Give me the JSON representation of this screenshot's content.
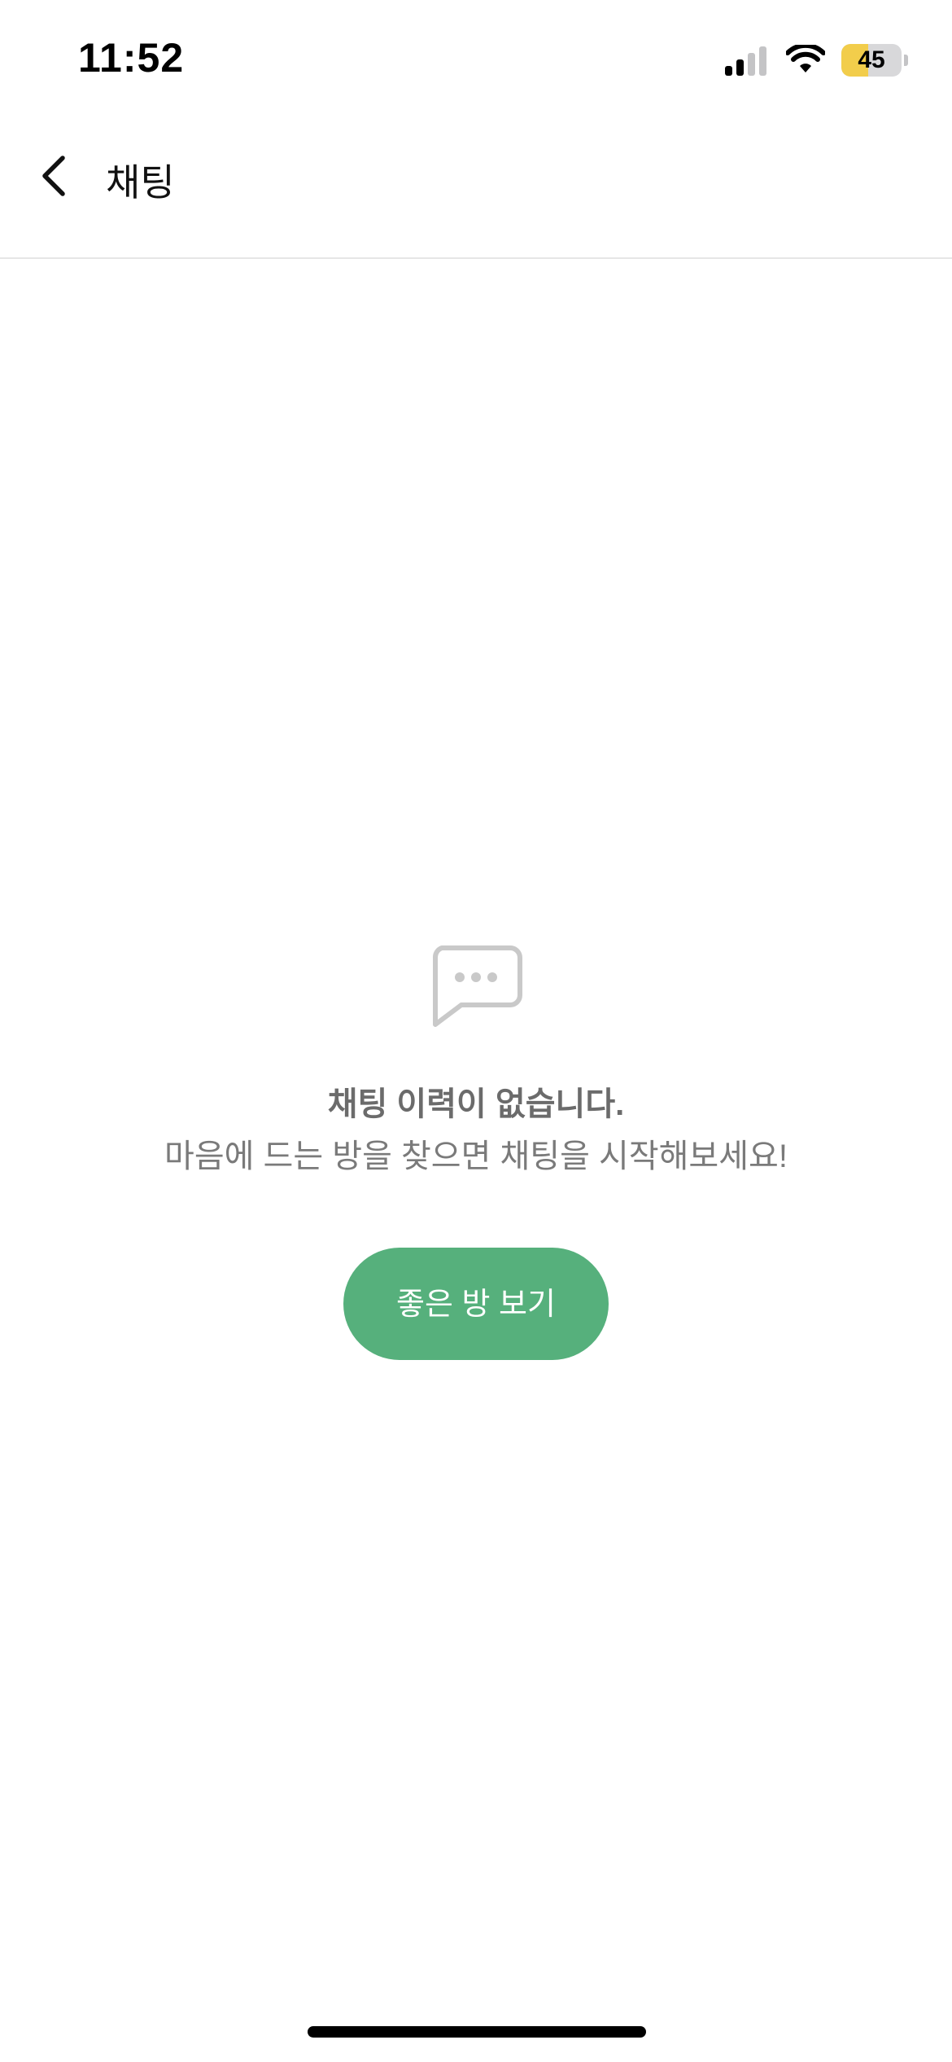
{
  "status_bar": {
    "time": "11:52",
    "signal_icon": "cellular-signal-icon",
    "signal_bars_active": 2,
    "signal_bars_total": 4,
    "wifi_icon": "wifi-icon",
    "battery_icon": "battery-icon",
    "battery_level": "45",
    "battery_fraction": 0.45,
    "battery_color": "#f2cd4b"
  },
  "nav": {
    "back_icon": "chevron-left-icon",
    "title": "채팅"
  },
  "empty_state": {
    "icon": "chat-bubble-icon",
    "title": "채팅 이력이 없습니다.",
    "subtitle": "마음에 드는 방을 찾으면 채팅을 시작해보세요!",
    "button_label": "좋은 방 보기",
    "button_color": "#56b07c"
  }
}
